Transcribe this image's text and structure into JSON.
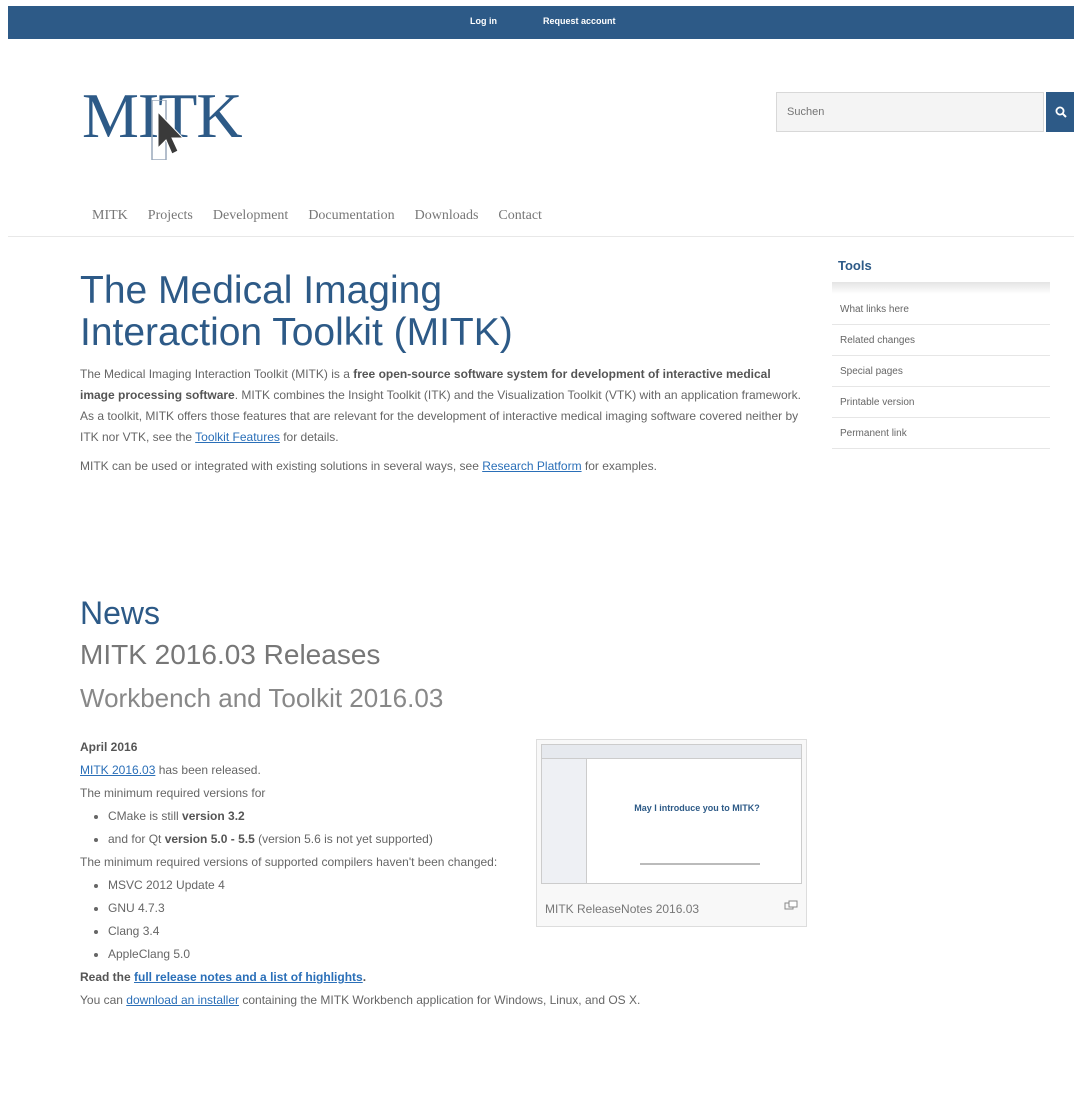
{
  "topbar": {
    "login": "Log in",
    "request": "Request account"
  },
  "logo": {
    "text": "MITK"
  },
  "search": {
    "placeholder": "Suchen"
  },
  "nav": [
    "MITK",
    "Projects",
    "Development",
    "Documentation",
    "Downloads",
    "Contact"
  ],
  "tools": {
    "title": "Tools",
    "items": [
      "What links here",
      "Related changes",
      "Special pages",
      "Printable version",
      "Permanent link"
    ]
  },
  "main": {
    "title": "The Medical Imaging Interaction Toolkit (MITK)",
    "intro": {
      "p1_a": "The Medical Imaging Interaction Toolkit (MITK) is a ",
      "p1_b": "free open-source software system for development of interactive medical image processing software",
      "p1_c": ". MITK combines the Insight Toolkit (ITK) and the Visualization Toolkit (VTK) with an application framework. As a toolkit, MITK offers those features that are relevant for the development of interactive medical imaging software covered neither by ITK nor VTK, see the ",
      "p1_link": "Toolkit Features",
      "p1_d": " for details.",
      "p2_a": "MITK can be used or integrated with existing solutions in several ways, see ",
      "p2_link": "Research Platform",
      "p2_b": " for examples."
    }
  },
  "news": {
    "heading": "News",
    "release": "MITK 2016.03 Releases",
    "sub": "Workbench and Toolkit 2016.03",
    "date": "April 2016",
    "released_link": "MITK 2016.03",
    "released_text": " has been released.",
    "min_req": "The minimum required versions for",
    "req_items": [
      {
        "a": "CMake is still ",
        "b": "version 3.2",
        "c": ""
      },
      {
        "a": "and for Qt ",
        "b": "version 5.0 - 5.5",
        "c": " (version 5.6 is not yet supported)"
      }
    ],
    "compilers_text": "The minimum required versions of supported compilers haven't been changed:",
    "compilers": [
      "MSVC 2012 Update 4",
      "GNU 4.7.3",
      "Clang 3.4",
      "AppleClang 5.0"
    ],
    "read_a": "Read the ",
    "read_link": "full release notes and a list of highlights",
    "read_b": ".",
    "dl_a": "You can ",
    "dl_link": "download an installer",
    "dl_b": " containing the MITK Workbench application for Windows, Linux, and OS X."
  },
  "thumb": {
    "slide_text": "May I introduce you to MITK?",
    "caption": "MITK ReleaseNotes 2016.03"
  },
  "colors": {
    "brand": "#2d5a87",
    "link": "#2a6fb8"
  }
}
